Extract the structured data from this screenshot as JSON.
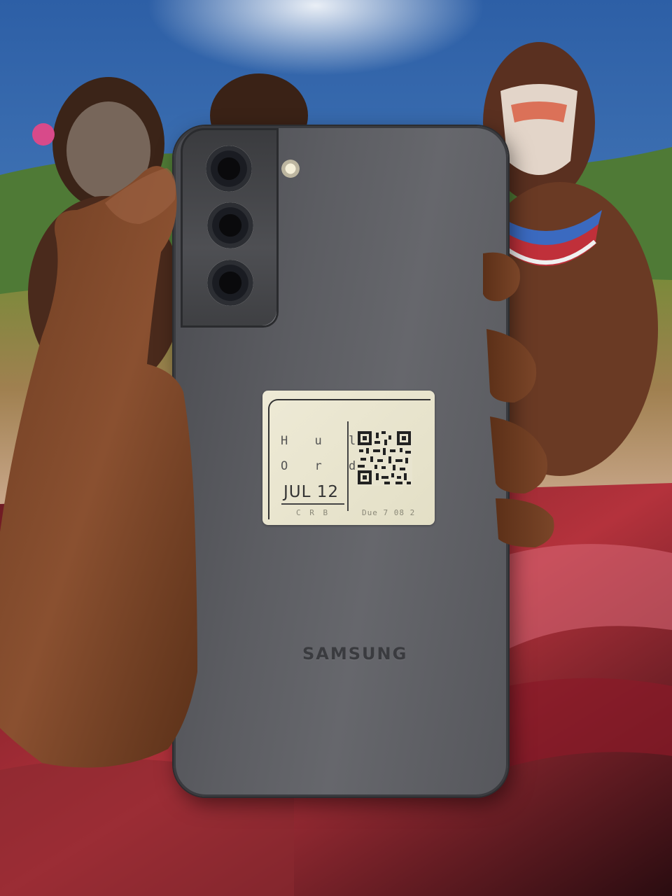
{
  "photo": {
    "brand_text": "SAMSUNG",
    "sticker": {
      "line1": "H u l",
      "line2": "O r d e",
      "date": "JUL 12",
      "footer_left": "C R B",
      "footer_right": "Due 7 08 2"
    }
  }
}
